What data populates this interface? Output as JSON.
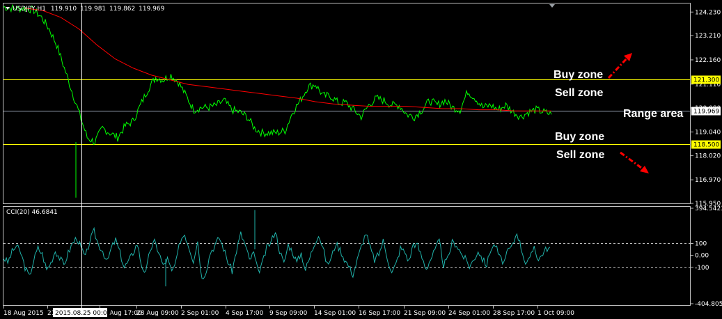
{
  "header": {
    "symbol": "USDJPY,H1",
    "o": "119.910",
    "h": "119.981",
    "l": "119.862",
    "c": "119.969"
  },
  "indicator_label": "CCI(20) 46.6841",
  "crosshair_time": "2015.08.25 00:00",
  "annotations": {
    "buy_zone_upper": "Buy zone",
    "sell_zone_upper": "Sell zone",
    "range_area": "Range area",
    "buy_zone_lower": "Buy zone",
    "sell_zone_lower": "Sell zone"
  },
  "colors": {
    "price": "#00ff00",
    "ma": "#ff0000",
    "levels": "#ffff00",
    "cci": "#20b2aa",
    "arrow": "#ff0000",
    "grid": "#c0c0c0"
  },
  "chart_data": [
    {
      "type": "line",
      "title": "USDJPY,H1",
      "y_ticks": [
        "124.230",
        "123.210",
        "122.160",
        "121.110",
        "120.080",
        "119.040",
        "118.020",
        "116.970",
        "115.950"
      ],
      "x_ticks": [
        "18 Aug 2015",
        "21 Aug 2015",
        "25 Aug 17:00",
        "28 Aug 09:00",
        "2 Sep 01:00",
        "4 Sep 17:00",
        "9 Sep 09:00",
        "14 Sep 01:00",
        "16 Sep 17:00",
        "21 Sep 09:00",
        "24 Sep 01:00",
        "28 Sep 17:00",
        "1 Oct 09:00"
      ],
      "ylim": [
        115.95,
        124.6
      ],
      "levels": [
        {
          "value": 121.3,
          "label": "121.300"
        },
        {
          "value": 118.5,
          "label": "118.500"
        }
      ],
      "current_price": {
        "value": 119.969,
        "label": "119.969"
      },
      "series": [
        {
          "values": [
            124.45,
            124.4,
            124.38,
            124.4,
            124.3,
            124.0,
            123.5,
            122.8,
            121.8,
            120.8,
            119.8,
            118.8,
            118.6,
            119.2,
            119.0,
            118.8,
            119.3,
            119.5,
            120.2,
            120.9,
            121.4,
            121.3,
            121.5,
            121.2,
            120.6,
            120.0,
            120.1,
            120.1,
            120.2,
            120.4,
            120.0,
            119.9,
            119.7,
            119.2,
            119.0,
            119.0,
            119.0,
            119.1,
            119.9,
            120.4,
            121.0,
            121.1,
            120.6,
            120.6,
            120.3,
            120.3,
            120.0,
            119.7,
            120.2,
            120.5,
            120.4,
            120.2,
            120.2,
            119.8,
            119.7,
            120.0,
            120.4,
            120.2,
            120.4,
            120.1,
            120.0,
            120.8,
            120.5,
            120.1,
            120.2,
            120.0,
            120.2,
            119.9,
            119.7,
            119.9,
            120.0,
            119.9,
            119.8
          ]
        },
        {
          "values": [
            124.4,
            124.3,
            124.0,
            123.5,
            122.8,
            122.2,
            121.8,
            121.5,
            121.3,
            121.1,
            121.0,
            120.9,
            120.8,
            120.7,
            120.6,
            120.5,
            120.35,
            120.25,
            120.2,
            120.15,
            120.15,
            120.15,
            120.1,
            120.05,
            120.05,
            120.0,
            120.0,
            119.95,
            119.95,
            119.95
          ]
        }
      ]
    },
    {
      "type": "line",
      "title": "CCI(20) 46.6841",
      "y_ticks": [
        "394.5423",
        "100",
        "0.00",
        "-100",
        "-404.805"
      ],
      "ylim": [
        -404.805,
        394.5423
      ],
      "levels": [
        100,
        -100
      ],
      "series": [
        {
          "values": [
            -20,
            -60,
            30,
            80,
            20,
            -100,
            -180,
            -40,
            60,
            10,
            -120,
            -60,
            40,
            -20,
            -80,
            20,
            100,
            150,
            60,
            -20,
            120,
            200,
            90,
            40,
            -60,
            60,
            130,
            20,
            -100,
            -50,
            20,
            100,
            -80,
            -150,
            50,
            110,
            30,
            -90,
            -30,
            -140,
            -60,
            130,
            180,
            70,
            -40,
            120,
            -200,
            -120,
            30,
            80,
            150,
            60,
            -50,
            -130,
            40,
            180,
            90,
            -40,
            20,
            -140,
            -70,
            60,
            110,
            210,
            40,
            -70,
            90,
            30,
            -60,
            20,
            -120,
            -20,
            90,
            180,
            70,
            -80,
            -20,
            100,
            50,
            -30,
            -90,
            -160,
            -40,
            80,
            190,
            60,
            -40,
            10,
            120,
            -20,
            -150,
            -70,
            60,
            30,
            -50,
            100,
            80,
            -20,
            -110,
            -30,
            40,
            120,
            -80,
            -30,
            110,
            90,
            20,
            -30,
            -90,
            -40,
            40,
            -30,
            -80,
            60,
            90,
            -20,
            -60,
            40,
            80,
            200,
            60,
            -60,
            -40,
            80,
            -40,
            20,
            60,
            50
          ]
        }
      ]
    }
  ]
}
